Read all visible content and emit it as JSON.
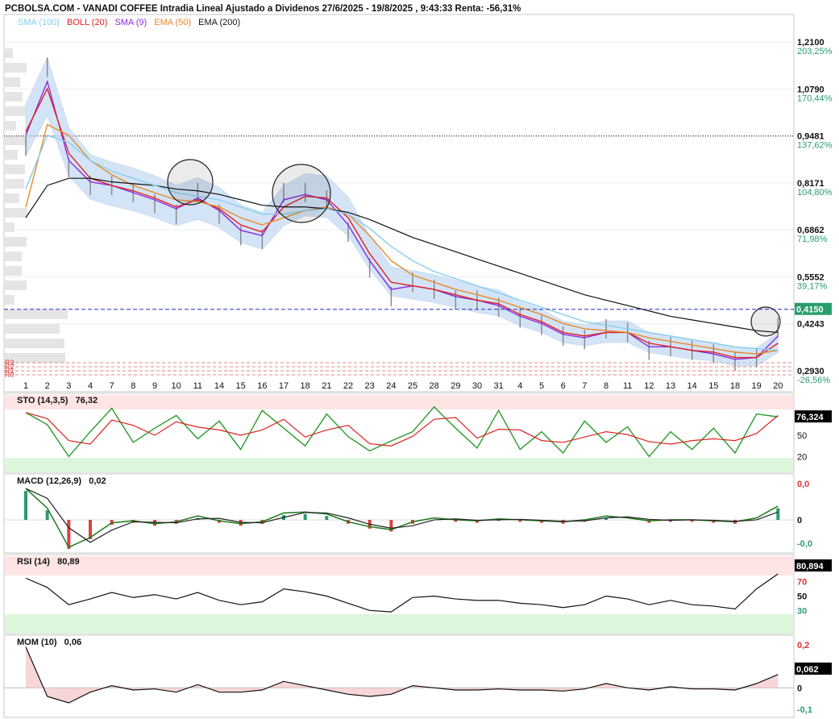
{
  "header": {
    "title": "PCBOLSA.COM - VANADI COFFEE Intradia Lineal Ajustado a Dividenos 27/6/2025 - 19/8/2025 , 9:43:33 Renta: -56,31%"
  },
  "legend": [
    {
      "label": "SMA (100)",
      "color": "#87ceeb"
    },
    {
      "label": "BOLL (20)",
      "color": "#dd2222"
    },
    {
      "label": "SMA (9)",
      "color": "#8a2be2"
    },
    {
      "label": "EMA (50)",
      "color": "#e88a2a"
    },
    {
      "label": "EMA (200)",
      "color": "#111111"
    }
  ],
  "colors": {
    "price_bar": "#8a8a8a",
    "boll_band": "#b9d3f2",
    "stoch_k": "#2a9a2a",
    "stoch_d": "#dd2222",
    "overbought_zone": "#ffe4e4",
    "oversold_zone": "#dcf6dc",
    "current_price_line": "#1c2fb5",
    "current_price_badge": "#2a9d6c",
    "value_badge": "#000000"
  },
  "price_panel": {
    "y_ticks": [
      {
        "value": "1,2100",
        "pct": "203,25%"
      },
      {
        "value": "1,0790",
        "pct": "170,44%"
      },
      {
        "value": "0,9481",
        "pct": "137,62%"
      },
      {
        "value": "0,8171",
        "pct": "104,80%"
      },
      {
        "value": "0,6862",
        "pct": "71,98%"
      },
      {
        "value": "0,5552",
        "pct": "39,17%"
      },
      {
        "value": "0,4243",
        "pct": ""
      },
      {
        "value": "0,2930",
        "pct": "-26,56%"
      }
    ],
    "current_price": "0,4150",
    "dotted_level": 0.9481,
    "support_labels": [
      "R3",
      "R2",
      "R1",
      "R0"
    ]
  },
  "x_labels": [
    "1",
    "2",
    "3",
    "4",
    "7",
    "8",
    "9",
    "10",
    "11",
    "14",
    "15",
    "16",
    "17",
    "18",
    "21",
    "22",
    "23",
    "24",
    "25",
    "28",
    "29",
    "30",
    "31",
    "4",
    "5",
    "6",
    "7",
    "8",
    "11",
    "12",
    "13",
    "14",
    "15",
    "18",
    "19",
    "20"
  ],
  "panels": {
    "sto": {
      "label": "STO (14,3,5)",
      "value_text": "76,32",
      "badge": "76,324",
      "ticks": [
        "50",
        "20"
      ]
    },
    "macd": {
      "label": "MACD (12,26,9)",
      "value_text": "0,02",
      "ticks": [
        "0,0",
        "0",
        "-0,0"
      ]
    },
    "rsi": {
      "label": "RSI (14)",
      "value_text": "80,89",
      "badge": "80,894",
      "ticks": [
        "70",
        "50",
        "30"
      ]
    },
    "mom": {
      "label": "MOM (10)",
      "value_text": "0,06",
      "badge": "0,062",
      "ticks": [
        "0,2",
        "0",
        "-0,1"
      ]
    }
  },
  "chart_data": {
    "type": "line",
    "title": "PCBOLSA.COM - VANADI COFFEE Intradia Lineal Ajustado a Dividenos 27/6/2025 - 19/8/2025 , 9:43:33 Renta: -56,31%",
    "categories": [
      "1",
      "2",
      "3",
      "4",
      "7",
      "8",
      "9",
      "10",
      "11",
      "14",
      "15",
      "16",
      "17",
      "18",
      "21",
      "22",
      "23",
      "24",
      "25",
      "28",
      "29",
      "30",
      "31",
      "4",
      "5",
      "6",
      "7",
      "8",
      "11",
      "12",
      "13",
      "14",
      "15",
      "18",
      "19",
      "20"
    ],
    "ylim": [
      0.275,
      1.26
    ],
    "series": [
      {
        "name": "Precio",
        "values": [
          0.92,
          1.14,
          0.86,
          0.81,
          0.81,
          0.79,
          0.76,
          0.73,
          0.79,
          0.73,
          0.67,
          0.66,
          0.79,
          0.79,
          0.77,
          0.68,
          0.58,
          0.5,
          0.54,
          0.52,
          0.49,
          0.49,
          0.47,
          0.44,
          0.42,
          0.39,
          0.38,
          0.41,
          0.4,
          0.35,
          0.36,
          0.35,
          0.34,
          0.32,
          0.33,
          0.415
        ]
      },
      {
        "name": "SMA (9)",
        "values": [
          0.95,
          1.1,
          0.88,
          0.82,
          0.81,
          0.79,
          0.77,
          0.745,
          0.775,
          0.74,
          0.685,
          0.67,
          0.77,
          0.785,
          0.77,
          0.7,
          0.6,
          0.52,
          0.53,
          0.52,
          0.5,
          0.49,
          0.475,
          0.445,
          0.425,
          0.395,
          0.385,
          0.4,
          0.4,
          0.36,
          0.36,
          0.35,
          0.34,
          0.325,
          0.33,
          0.39
        ]
      },
      {
        "name": "BOLL (20)",
        "values": [
          0.96,
          1.08,
          0.9,
          0.83,
          0.81,
          0.795,
          0.775,
          0.75,
          0.77,
          0.745,
          0.7,
          0.68,
          0.75,
          0.78,
          0.775,
          0.72,
          0.62,
          0.54,
          0.53,
          0.52,
          0.505,
          0.49,
          0.48,
          0.45,
          0.43,
          0.4,
          0.39,
          0.4,
          0.4,
          0.37,
          0.36,
          0.35,
          0.345,
          0.33,
          0.33,
          0.37
        ]
      },
      {
        "name": "EMA (50)",
        "values": [
          0.75,
          0.98,
          0.95,
          0.88,
          0.84,
          0.81,
          0.79,
          0.77,
          0.765,
          0.75,
          0.72,
          0.7,
          0.72,
          0.74,
          0.75,
          0.73,
          0.67,
          0.6,
          0.56,
          0.54,
          0.52,
          0.505,
          0.49,
          0.47,
          0.45,
          0.425,
          0.41,
          0.405,
          0.4,
          0.385,
          0.375,
          0.365,
          0.355,
          0.345,
          0.34,
          0.35
        ]
      },
      {
        "name": "EMA (200)",
        "values": [
          0.72,
          0.81,
          0.83,
          0.83,
          0.82,
          0.815,
          0.81,
          0.8,
          0.795,
          0.785,
          0.77,
          0.755,
          0.75,
          0.75,
          0.745,
          0.735,
          0.715,
          0.69,
          0.665,
          0.645,
          0.625,
          0.605,
          0.585,
          0.565,
          0.545,
          0.525,
          0.505,
          0.49,
          0.475,
          0.46,
          0.445,
          0.435,
          0.425,
          0.415,
          0.405,
          0.4
        ]
      },
      {
        "name": "SMA (100)",
        "values": [
          0.8,
          0.95,
          0.93,
          0.88,
          0.85,
          0.83,
          0.81,
          0.79,
          0.78,
          0.77,
          0.75,
          0.73,
          0.73,
          0.74,
          0.745,
          0.73,
          0.69,
          0.64,
          0.6,
          0.57,
          0.55,
          0.53,
          0.51,
          0.49,
          0.47,
          0.45,
          0.43,
          0.42,
          0.41,
          0.4,
          0.39,
          0.38,
          0.37,
          0.36,
          0.355,
          0.35
        ]
      }
    ],
    "indicators": {
      "sto": [
        82,
        65,
        20,
        55,
        88,
        40,
        60,
        78,
        45,
        70,
        30,
        85,
        60,
        35,
        80,
        48,
        28,
        42,
        55,
        90,
        60,
        32,
        85,
        30,
        55,
        25,
        70,
        40,
        62,
        20,
        55,
        30,
        60,
        25,
        80,
        76
      ],
      "macd": [
        0.03,
        0.01,
        -0.03,
        -0.02,
        -0.005,
        -0.003,
        -0.006,
        -0.004,
        0.002,
        -0.003,
        -0.006,
        -0.004,
        0.005,
        0.006,
        0.004,
        -0.004,
        -0.009,
        -0.012,
        -0.004,
        0.0,
        -0.002,
        -0.003,
        -0.001,
        -0.002,
        -0.003,
        -0.004,
        -0.002,
        0.002,
        0.0,
        -0.003,
        -0.002,
        -0.002,
        -0.003,
        -0.004,
        0.0,
        0.012
      ],
      "rsi": [
        75,
        62,
        38,
        46,
        55,
        48,
        52,
        46,
        55,
        44,
        38,
        42,
        60,
        56,
        50,
        40,
        30,
        28,
        48,
        50,
        46,
        44,
        44,
        40,
        38,
        34,
        38,
        50,
        46,
        38,
        44,
        38,
        36,
        32,
        60,
        80.89
      ],
      "mom": [
        0.19,
        -0.04,
        -0.07,
        -0.02,
        0.01,
        -0.01,
        -0.005,
        -0.02,
        0.015,
        -0.02,
        -0.02,
        -0.01,
        0.03,
        0.01,
        -0.01,
        -0.03,
        -0.04,
        -0.03,
        0.01,
        0.0,
        -0.01,
        -0.01,
        -0.005,
        -0.01,
        -0.01,
        -0.015,
        -0.005,
        0.02,
        0.0,
        -0.01,
        0.005,
        -0.005,
        -0.005,
        -0.01,
        0.02,
        0.062
      ]
    }
  }
}
